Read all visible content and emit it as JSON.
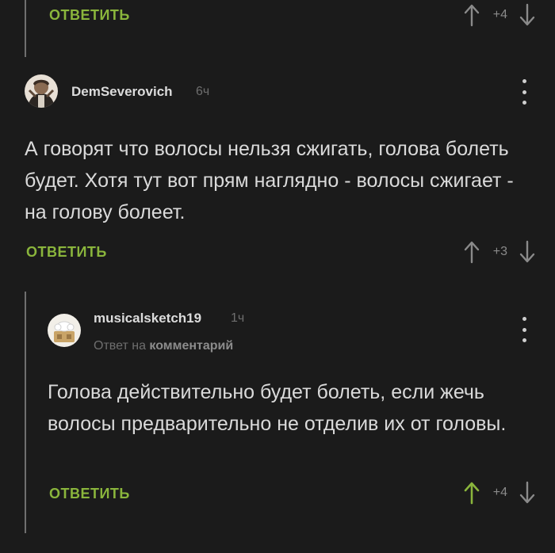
{
  "top_item": {
    "reply_label": "ОТВЕТИТЬ",
    "score": "+4"
  },
  "comment1": {
    "username": "DemSeverovich",
    "time": "6ч",
    "text": "А говорят что волосы нельзя сжигать, голова болеть будет. Хотя тут вот прям наглядно - волосы сжигает - на голову болеет.",
    "reply_label": "ОТВЕТИТЬ",
    "score": "+3",
    "avatar_icon": "user-avatar"
  },
  "comment2": {
    "username": "musicalsketch19",
    "time": "1ч",
    "reply_to_prefix": "Ответ на",
    "reply_to_link": "комментарий",
    "text": "Голова действительно будет болеть, если жечь волосы предварительно не отделив их от головы.",
    "reply_label": "ОТВЕТИТЬ",
    "score": "+4",
    "upvoted": true,
    "avatar_icon": "user-avatar"
  },
  "colors": {
    "background": "#1b1b1b",
    "accent_green": "#8ab53c",
    "text": "#dadada",
    "muted": "#6e6e6e"
  }
}
